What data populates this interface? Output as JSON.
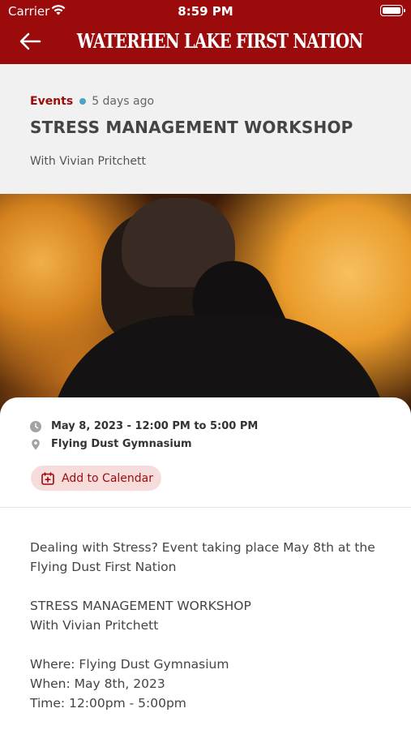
{
  "status_bar": {
    "carrier": "Carrier",
    "time": "8:59 PM"
  },
  "header": {
    "title": "WATERHEN LAKE FIRST NATION"
  },
  "post": {
    "category": "Events",
    "posted": "5 days ago",
    "title": "STRESS MANAGEMENT WORKSHOP",
    "subtitle": "With Vivian Pritchett"
  },
  "details": {
    "datetime": "May 8, 2023 - 12:00 PM to 5:00 PM",
    "location": "Flying Dust Gymnasium",
    "add_to_calendar": "Add to Calendar"
  },
  "description": {
    "para1": "Dealing with Stress? Event taking place May 8th at the Flying Dust First Nation",
    "para2_line1": "STRESS MANAGEMENT WORKSHOP",
    "para2_line2": "With Vivian Pritchett",
    "para3_line1": "Where: Flying Dust Gymnasium",
    "para3_line2": "When: May 8th, 2023",
    "para3_line3": "Time: 12:00pm - 5:00pm"
  },
  "colors": {
    "brand": "#9b0b0b",
    "accent_dot": "#4ba3c7",
    "button_bg": "#f7dcdc"
  },
  "icons": [
    "wifi-icon",
    "battery-icon",
    "back-arrow-icon",
    "clock-icon",
    "location-pin-icon",
    "calendar-add-icon"
  ]
}
